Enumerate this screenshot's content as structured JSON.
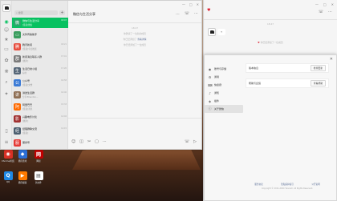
{
  "desktop": {
    "icons": [
      {
        "label": "Chrome浏览器",
        "icon": "chrome-icon",
        "color": "#d93025",
        "glyph": "◉"
      },
      {
        "label": "腾讯游戏",
        "icon": "game-icon",
        "color": "#2d6fd6",
        "glyph": "◆"
      },
      {
        "label": "网易",
        "icon": "app-icon",
        "color": "#c00000",
        "glyph": "网"
      },
      {
        "label": "QQ",
        "icon": "qq-icon",
        "color": "#1e88e5",
        "glyph": "Q"
      },
      {
        "label": "腾讯视频",
        "icon": "video-icon",
        "color": "#ff7a00",
        "glyph": "▶"
      },
      {
        "label": "新文件",
        "icon": "file-icon",
        "color": "#ffffff",
        "glyph": "▤"
      }
    ]
  },
  "chat_window": {
    "rail_icons": [
      "chat-icon",
      "contacts-icon",
      "favorites-icon",
      "files-icon",
      "moments-icon",
      "channels-icon",
      "search-icon",
      "mini-program-icon",
      "phone-icon",
      "menu-icon"
    ],
    "search_placeholder": "搜索",
    "plus_label": "+",
    "conversations": [
      {
        "name": "微信与生活分享",
        "preview": "[链接]微信",
        "time": "18:47",
        "color": "#2aa86a",
        "glyph": "微",
        "active": true
      },
      {
        "name": "文件传输助手",
        "preview": "",
        "time": "",
        "color": "#3a9d5d",
        "glyph": "▭",
        "active": false
      },
      {
        "name": "腾讯新闻",
        "preview": "[链接]今日推送",
        "time": "18:21",
        "color": "#e74c3c",
        "glyph": "腾",
        "active": false
      },
      {
        "name": "新闻消息联系人群",
        "preview": "[图片]",
        "time": "17:41",
        "color": "#7a7a7a",
        "glyph": "群",
        "active": false
      },
      {
        "name": "生活日常小组",
        "preview": "好的",
        "time": "17:20",
        "color": "#556677",
        "glyph": "生",
        "active": false
      },
      {
        "name": "公众号",
        "preview": "[链接]文章",
        "time": "16:58",
        "color": "#3b7bd6",
        "glyph": "公",
        "active": false
      },
      {
        "name": "讲述生活群",
        "preview": "分享:Brandon...",
        "time": "16:40",
        "color": "#8e6e53",
        "glyph": "讲",
        "active": false
      },
      {
        "name": "阿里巴巴",
        "preview": "[链接]消息",
        "time": "15:33",
        "color": "#ff6a00",
        "glyph": "阿",
        "active": false
      },
      {
        "name": "兴趣电影讨论",
        "preview": "[图片]",
        "time": "14:02",
        "color": "#a03030",
        "glyph": "影",
        "active": false
      },
      {
        "name": "经理群聊交流",
        "preview": "[链接]",
        "time": "12:15",
        "color": "#4a5d6e",
        "glyph": "经",
        "active": false
      },
      {
        "name": "服务号",
        "preview": "",
        "time": "",
        "color": "#e53935",
        "glyph": "服",
        "active": false
      }
    ],
    "header": {
      "title": "微信与生活分享",
      "window_controls": [
        "—",
        "□",
        "✕"
      ],
      "icons": [
        "...",
        "☏",
        "⋯"
      ]
    },
    "messages": {
      "time": "18:47",
      "system1": "你邀请了一位新的成员",
      "system2_prefix": "你已经添加了",
      "system2_link": "查看详情",
      "system3": "你已经添加了一位成员"
    },
    "input_tools": [
      "☺",
      "◫",
      "✂",
      "▢",
      "⋯"
    ],
    "input_tools_right": [
      "☏",
      "▷"
    ]
  },
  "right_window": {
    "window_controls": [
      "—",
      "□",
      "✕"
    ],
    "header_icons": [
      "☏",
      "⋯"
    ],
    "time": "18:47",
    "bubble_text": "T",
    "system_text": "你已经添加了一位成员"
  },
  "settings": {
    "close_label": "✕",
    "menu": [
      {
        "label": "账号与存储",
        "icon": "account-icon",
        "glyph": "◉",
        "active": false
      },
      {
        "label": "通用",
        "icon": "gear-icon",
        "glyph": "⚙",
        "active": false
      },
      {
        "label": "快捷键",
        "icon": "keyboard-icon",
        "glyph": "⌨",
        "active": false
      },
      {
        "label": "通知",
        "icon": "bell-icon",
        "glyph": "♪",
        "active": false
      },
      {
        "label": "插件",
        "icon": "plugin-icon",
        "glyph": "◈",
        "active": false
      },
      {
        "label": "关于微信",
        "icon": "info-icon",
        "glyph": "ⓘ",
        "active": true
      }
    ],
    "rows": [
      {
        "label": "版本信息",
        "button": "检查更新"
      },
      {
        "label": "帮助与反馈",
        "button": "查看帮助"
      }
    ],
    "links": [
      "服务协议",
      "隐私保护指引",
      "公开说明"
    ],
    "copyright": "Copyright © 2011-2024 Tencent. All Rights Reserved."
  }
}
